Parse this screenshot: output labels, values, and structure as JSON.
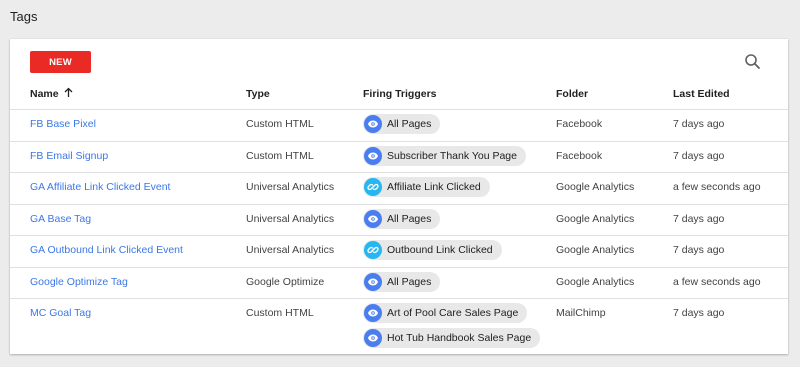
{
  "page": {
    "title": "Tags"
  },
  "toolbar": {
    "new_label": "NEW",
    "search_icon": "search-icon"
  },
  "colors": {
    "new_button": "#ea2a25",
    "link": "#3b78e7",
    "eye_icon_bg": "#4a7ef0",
    "link_icon_bg": "#26b6f0",
    "chip_bg": "#e8e8e8"
  },
  "table": {
    "headers": {
      "name": "Name",
      "name_sort": "ascending",
      "type": "Type",
      "triggers": "Firing Triggers",
      "folder": "Folder",
      "edited": "Last Edited"
    },
    "rows": [
      {
        "name": "FB Base Pixel",
        "type": "Custom HTML",
        "triggers": [
          {
            "icon": "eye",
            "label": "All Pages"
          }
        ],
        "folder": "Facebook",
        "edited": "7 days ago"
      },
      {
        "name": "FB Email Signup",
        "type": "Custom HTML",
        "triggers": [
          {
            "icon": "eye",
            "label": "Subscriber Thank You Page"
          }
        ],
        "folder": "Facebook",
        "edited": "7 days ago"
      },
      {
        "name": "GA Affiliate Link Clicked Event",
        "type": "Universal Analytics",
        "triggers": [
          {
            "icon": "link",
            "label": "Affiliate Link Clicked"
          }
        ],
        "folder": "Google Analytics",
        "edited": "a few seconds ago"
      },
      {
        "name": "GA Base Tag",
        "type": "Universal Analytics",
        "triggers": [
          {
            "icon": "eye",
            "label": "All Pages"
          }
        ],
        "folder": "Google Analytics",
        "edited": "7 days ago"
      },
      {
        "name": "GA Outbound Link Clicked Event",
        "type": "Universal Analytics",
        "triggers": [
          {
            "icon": "link",
            "label": "Outbound Link Clicked"
          }
        ],
        "folder": "Google Analytics",
        "edited": "7 days ago"
      },
      {
        "name": "Google Optimize Tag",
        "type": "Google Optimize",
        "triggers": [
          {
            "icon": "eye",
            "label": "All Pages"
          }
        ],
        "folder": "Google Analytics",
        "edited": "a few seconds ago"
      },
      {
        "name": "MC Goal Tag",
        "type": "Custom HTML",
        "triggers": [
          {
            "icon": "eye",
            "label": "Art of Pool Care Sales Page"
          },
          {
            "icon": "eye",
            "label": "Hot Tub Handbook Sales Page"
          }
        ],
        "folder": "MailChimp",
        "edited": "7 days ago"
      }
    ]
  }
}
